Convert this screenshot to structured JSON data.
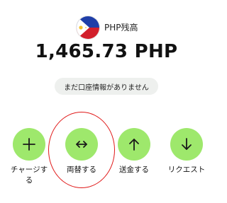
{
  "wallet": {
    "currency_label": "PHP残高",
    "flag_icon": "philippines-flag-icon",
    "balance": "1,465.73 PHP",
    "status": "まだ口座情報がありません"
  },
  "actions": [
    {
      "label": "チャージする",
      "icon": "plus-icon"
    },
    {
      "label": "両替する",
      "icon": "swap-horizontal-icon"
    },
    {
      "label": "送金する",
      "icon": "arrow-up-icon"
    },
    {
      "label": "リクエスト",
      "icon": "arrow-down-icon"
    }
  ],
  "colors": {
    "action_button": "#9ee86c",
    "highlight_ring": "#e01818",
    "status_pill": "#eef0ee",
    "text": "#111111"
  }
}
